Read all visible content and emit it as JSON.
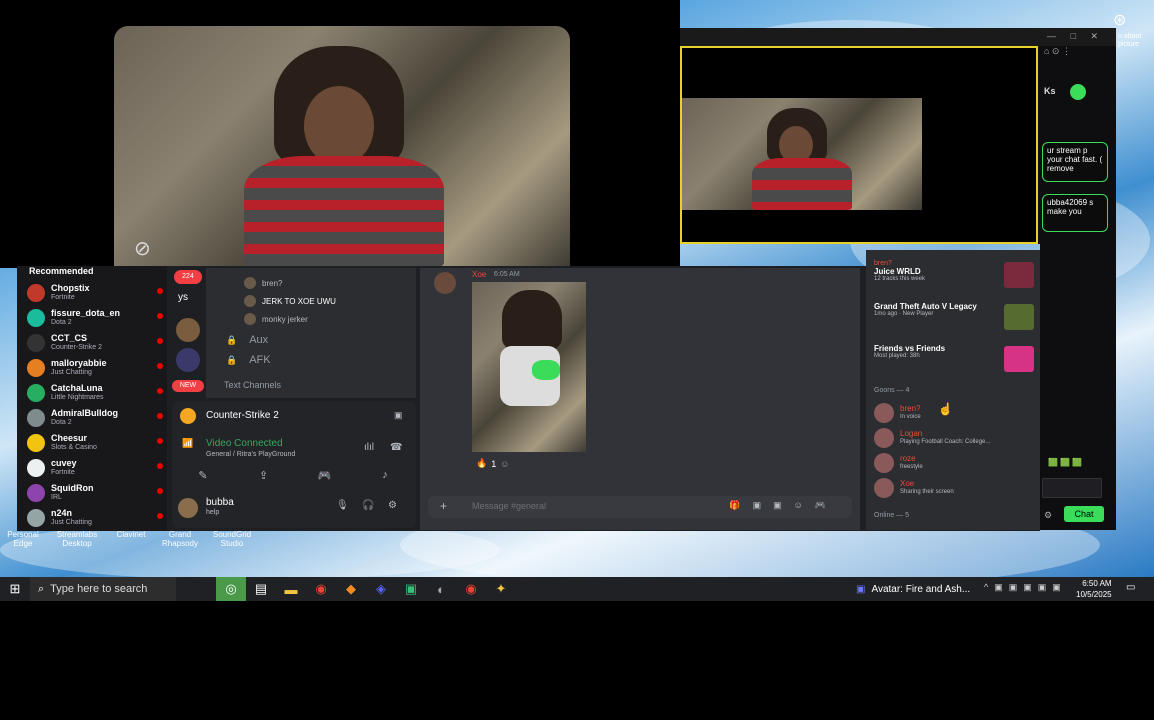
{
  "stream_sidebar": {
    "header": "Recommended",
    "channels": [
      {
        "name": "Chopstix",
        "game": "Fortnite",
        "color": "#c0392b"
      },
      {
        "name": "fissure_dota_en",
        "game": "Dota 2",
        "color": "#1abc9c"
      },
      {
        "name": "CCT_CS",
        "game": "Counter-Strike 2",
        "color": "#333333"
      },
      {
        "name": "malloryabbie",
        "game": "Just Chatting",
        "color": "#e67e22"
      },
      {
        "name": "CatchaLuna",
        "game": "Little Nightmares",
        "color": "#27ae60"
      },
      {
        "name": "AdmiralBulldog",
        "game": "Dota 2",
        "color": "#7f8c8d"
      },
      {
        "name": "Cheesur",
        "game": "Slots & Casino",
        "color": "#f1c40f"
      },
      {
        "name": "cuvey",
        "game": "Fortnite",
        "color": "#ecf0f1"
      },
      {
        "name": "SquidRon",
        "game": "IRL",
        "color": "#8e44ad"
      },
      {
        "name": "n24n",
        "game": "Just Chatting",
        "color": "#95a5a6"
      }
    ]
  },
  "discord": {
    "server_badge": "ys",
    "new_badge": "NEW",
    "badge_count": "224",
    "voice_users": [
      {
        "name": "bren?",
        "color": "#b5bac1"
      },
      {
        "name": "JERK TO XOE UWU",
        "color": "#ffffff"
      },
      {
        "name": "monky jerker",
        "color": "#b5bac1"
      }
    ],
    "channels": [
      "Aux",
      "AFK"
    ],
    "text_channels_label": "Text Channels",
    "activity_game": "Counter-Strike 2",
    "voice_status": "Video Connected",
    "voice_channel": "General / Ritra's PlayGround",
    "user_name": "bubba",
    "user_status": "help",
    "message_author": "Xoe",
    "message_time": "6:05 AM",
    "reaction_count": "1",
    "message_placeholder": "Message #general",
    "activity": [
      {
        "user": "bren?",
        "title": "Juice WRLD",
        "sub": "12 tracks this week"
      },
      {
        "user": "",
        "title": "Grand Theft Auto V Legacy",
        "sub": "1mo ago · New Player"
      },
      {
        "user": "",
        "title": "Friends vs Friends",
        "sub": "Most played: 38h"
      }
    ],
    "members_header": "Goons — 4",
    "members": [
      {
        "name": "bren?",
        "status": "In voice",
        "color": "#e74c3c"
      },
      {
        "name": "Logan",
        "status": "Playing Football Coach: College...",
        "color": "#e74c3c"
      },
      {
        "name": "roze",
        "status": "freestyle",
        "color": "#e74c3c"
      },
      {
        "name": "Xoe",
        "status": "Sharing their screen",
        "color": "#e74c3c"
      }
    ],
    "online_header": "Online — 5"
  },
  "chat": {
    "bubble1": "ur stream p your chat fast. ( remove",
    "bubble2": "ubba42069 s make you",
    "chat_button": "Chat",
    "header_text": "Ks"
  },
  "desktop_icons": [
    {
      "label": "Personal Edge"
    },
    {
      "label": "Streamlabs Desktop"
    },
    {
      "label": "Clavinet"
    },
    {
      "label": "Grand Rhapsody"
    },
    {
      "label": "SoundGrid Studio"
    }
  ],
  "pip_label": "n about picture",
  "taskbar": {
    "search_placeholder": "Type here to search",
    "now_playing": "Avatar: Fire and Ash...",
    "time": "6:50 AM",
    "date": "10/5/2025"
  }
}
